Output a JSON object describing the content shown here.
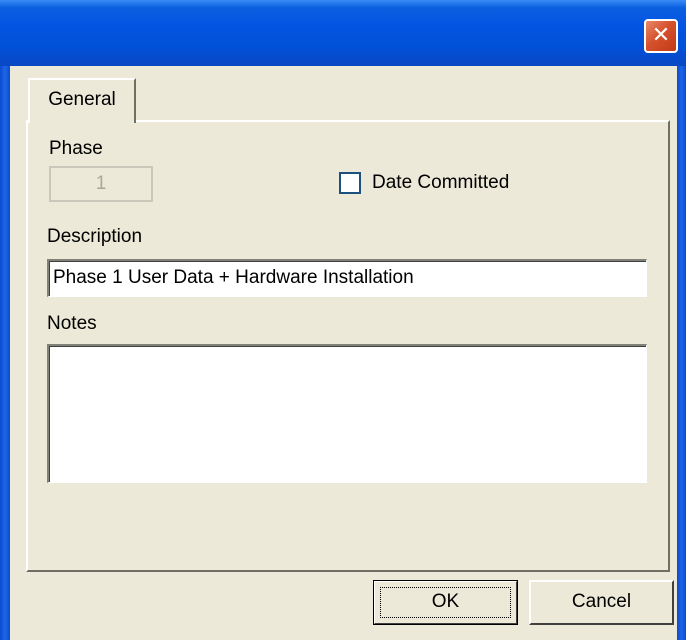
{
  "window": {
    "title": "",
    "close_icon": "close-icon"
  },
  "tabs": [
    {
      "label": "General",
      "active": true
    }
  ],
  "form": {
    "phase_label": "Phase",
    "phase_value": "1",
    "phase_disabled": true,
    "date_committed_label": "Date Committed",
    "date_committed_checked": false,
    "description_label": "Description",
    "description_value": "Phase 1 User Data + Hardware Installation",
    "notes_label": "Notes",
    "notes_value": ""
  },
  "buttons": {
    "ok_label": "OK",
    "cancel_label": "Cancel"
  },
  "colors": {
    "title_bar": "#0354E2",
    "close_button": "#D5512C",
    "dialog_background": "#ECE9D8"
  }
}
